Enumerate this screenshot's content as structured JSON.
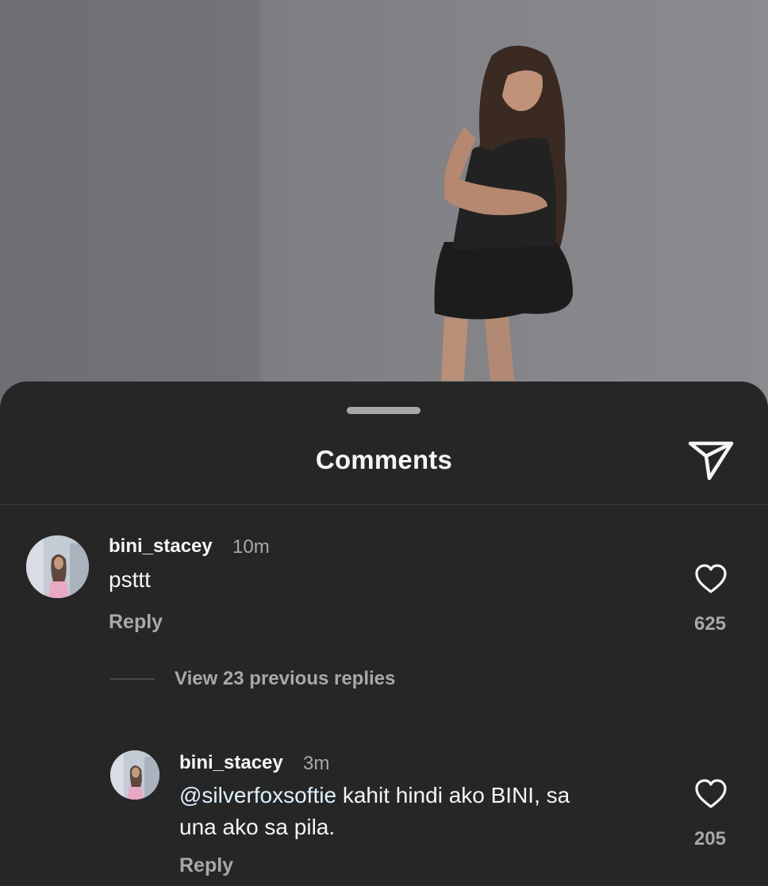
{
  "sheet": {
    "title": "Comments",
    "share_icon": "send-icon"
  },
  "comments": [
    {
      "username": "bini_stacey",
      "time": "10m",
      "text": "psttt",
      "reply_label": "Reply",
      "likes": "625",
      "view_replies": "View 23 previous replies"
    },
    {
      "username": "bini_stacey",
      "time": "3m",
      "mention": "@silverfoxsoftie",
      "text_line1": " kahit hindi ako BINI, sa",
      "text_line2": "una ako sa pila.",
      "reply_label": "Reply",
      "likes": "205"
    }
  ],
  "colors": {
    "sheet_bg": "#262626",
    "primary_text": "#f5f5f5",
    "secondary_text": "#a8a8a8",
    "mention": "#e0f1ff"
  }
}
